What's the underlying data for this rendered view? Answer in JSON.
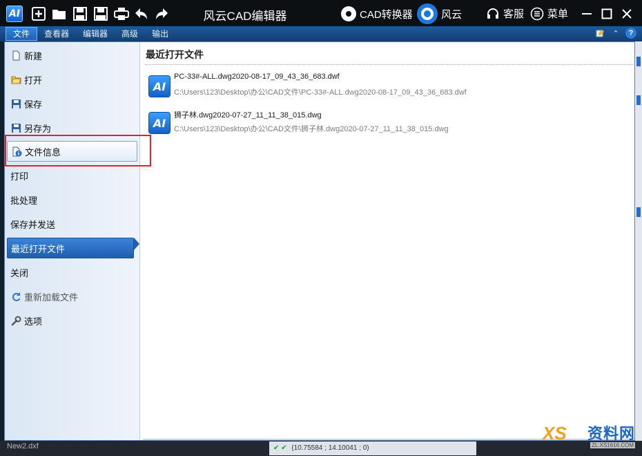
{
  "app": {
    "title": "风云CAD编辑器",
    "logo_text": "AI"
  },
  "titlebar": {
    "cad_converter_label": "CAD转换器",
    "fengyun_label": "风云",
    "service_label": "客服",
    "menu_label": "菜单"
  },
  "ribbon": {
    "tabs": [
      {
        "label": "文件",
        "active": true
      },
      {
        "label": "查看器",
        "active": false
      },
      {
        "label": "编辑器",
        "active": false
      },
      {
        "label": "高级",
        "active": false
      },
      {
        "label": "输出",
        "active": false
      }
    ],
    "help_label": "?"
  },
  "sidebar": {
    "items": [
      {
        "label": "新建",
        "icon": "new-file-icon"
      },
      {
        "label": "打开",
        "icon": "open-folder-icon"
      },
      {
        "label": "保存",
        "icon": "save-icon"
      },
      {
        "label": "另存为",
        "icon": "save-as-icon"
      },
      {
        "label": "文件信息",
        "icon": "file-info-icon",
        "state": "hover"
      },
      {
        "label": "打印"
      },
      {
        "label": "批处理"
      },
      {
        "label": "保存并发送"
      },
      {
        "label": "最近打开文件",
        "state": "selected"
      },
      {
        "label": "关闭"
      },
      {
        "label": "重新加载文件",
        "icon": "reload-icon",
        "state": "disabled"
      },
      {
        "label": "选项",
        "icon": "wrench-icon"
      }
    ]
  },
  "content": {
    "title": "最近打开文件",
    "recent_files": [
      {
        "name": "PC-33#-ALL.dwg2020-08-17_09_43_36_683.dwf",
        "path": "C:\\Users\\123\\Desktop\\办公\\CAD文件\\PC-33#-ALL.dwg2020-08-17_09_43_36_683.dwf",
        "icon_text": "AI"
      },
      {
        "name": "狮子林.dwg2020-07-27_11_11_38_015.dwg",
        "path": "C:\\Users\\123\\Desktop\\办公\\CAD文件\\狮子林.dwg2020-07-27_11_11_38_015.dwg",
        "icon_text": "AI"
      }
    ]
  },
  "statusbar": {
    "left_text": "New2.dxf",
    "coords": "(10.75584 ; 14.10041 ; 0)"
  },
  "watermark": {
    "main": "资料网",
    "x": "XS",
    "sub": "ZL.XS1616.COM"
  },
  "colors": {
    "accent": "#1f5eb1",
    "highlight_border": "#e5202a",
    "titlebar_bg": "#0d1013"
  }
}
